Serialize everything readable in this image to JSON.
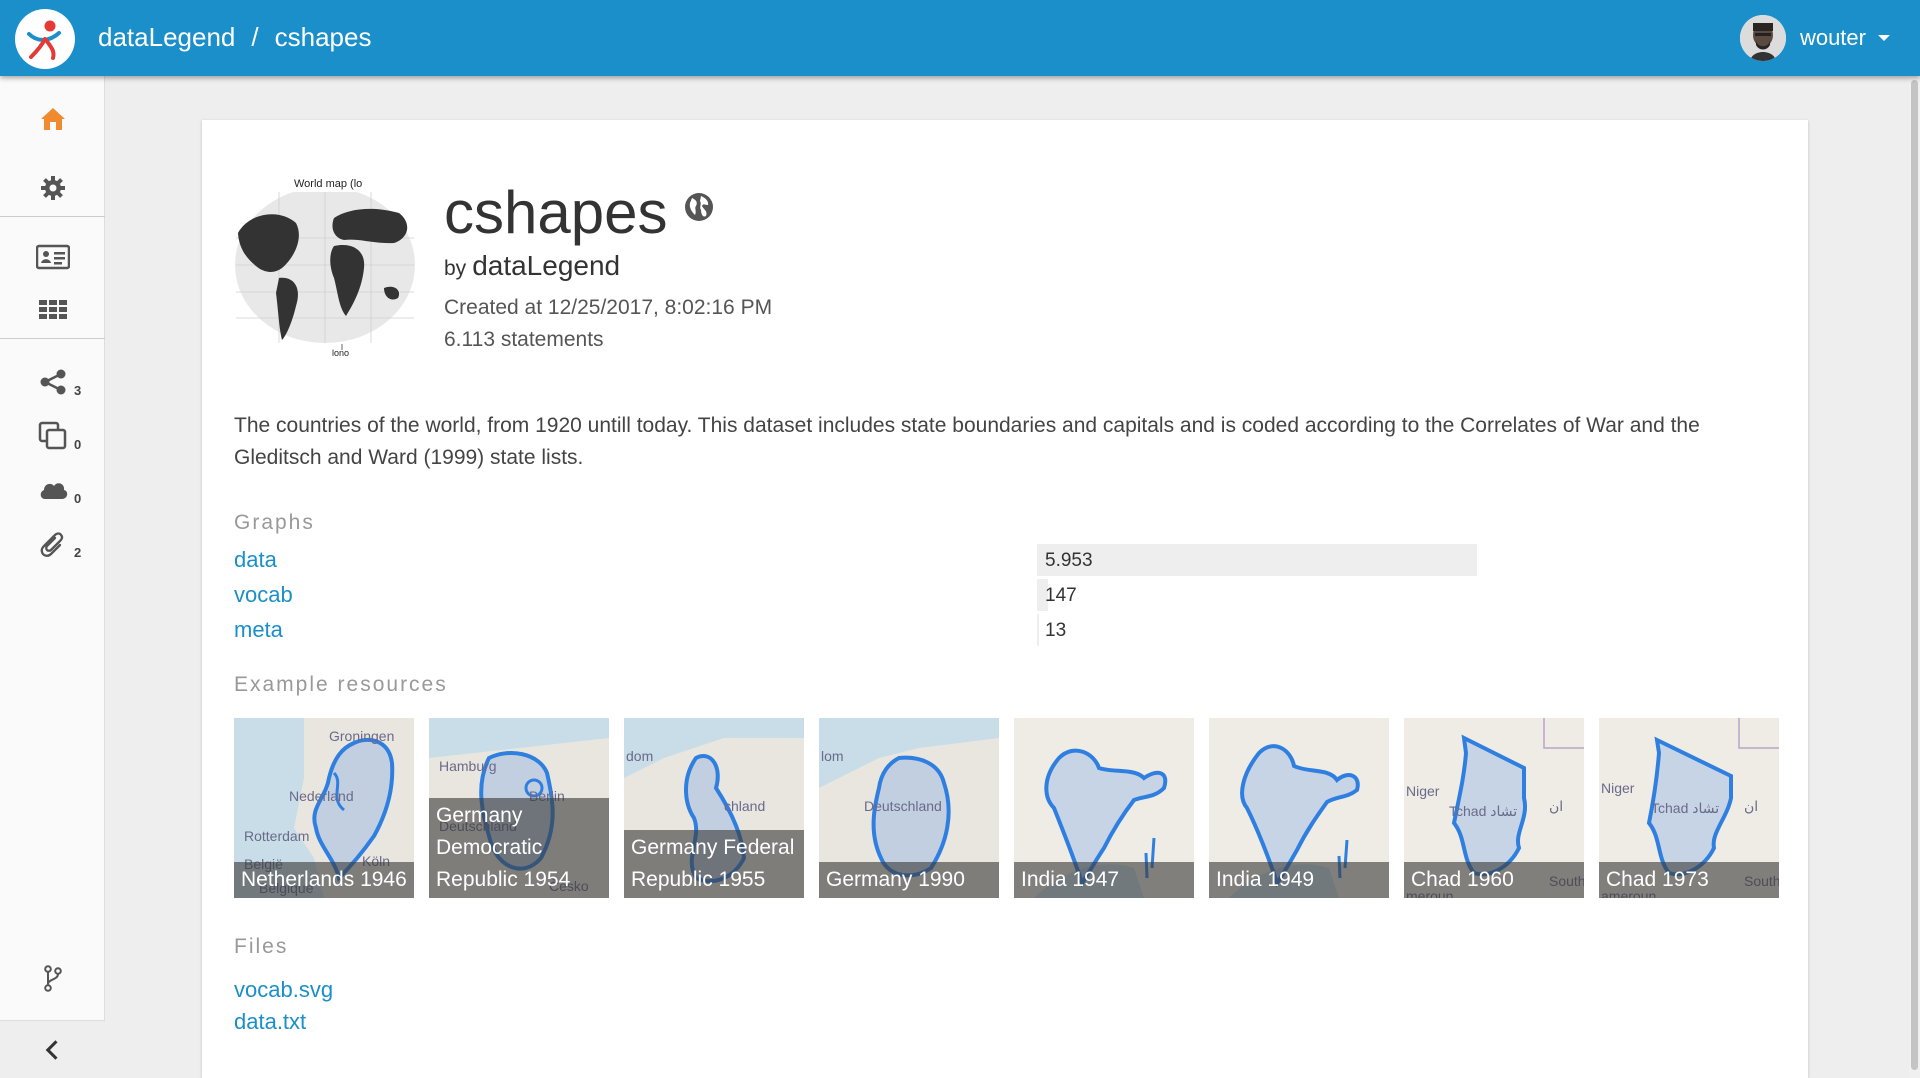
{
  "header": {
    "breadcrumb_org": "dataLegend",
    "breadcrumb_sep": "/",
    "breadcrumb_dataset": "cshapes",
    "user_name": "wouter"
  },
  "sidebar": {
    "counts": {
      "graphs": "3",
      "copies": "0",
      "services": "0",
      "assets": "2"
    }
  },
  "dataset": {
    "title": "cshapes",
    "by_prefix": "by",
    "owner": "dataLegend",
    "created": "Created at 12/25/2017, 8:02:16 PM",
    "statements": "6.113 statements",
    "description": "The countries of the world, from 1920 untill today. This dataset includes state boundaries and capitals and is coded according to the Correlates of War and the Gleditsch and Ward (1999) state lists.",
    "image_caption_top": "World map (lo",
    "image_caption_bottom": "lono"
  },
  "graphs": {
    "heading": "Graphs",
    "items": [
      {
        "name": "data",
        "count": "5.953",
        "fraction": 1.0
      },
      {
        "name": "vocab",
        "count": "147",
        "fraction": 0.025
      },
      {
        "name": "meta",
        "count": "13",
        "fraction": 0.005
      }
    ]
  },
  "examples": {
    "heading": "Example resources",
    "items": [
      {
        "label": "Netherlands 1946",
        "map_labels": [
          "Groningen",
          "Nederland",
          "Rotterdam",
          "België",
          "Belgique",
          "Köln"
        ]
      },
      {
        "label": "Germany Democratic Republic 1954",
        "map_labels": [
          "Hamburg",
          "Berlin",
          "Deutschland",
          "Česko"
        ]
      },
      {
        "label": "Germany Federal Republic 1955",
        "map_labels": [
          "dom",
          "chland"
        ]
      },
      {
        "label": "Germany 1990",
        "map_labels": [
          "lom",
          "Deutschland"
        ]
      },
      {
        "label": "India 1947",
        "map_labels": []
      },
      {
        "label": "India 1949",
        "map_labels": []
      },
      {
        "label": "Chad 1960",
        "map_labels": [
          "Niger",
          "Tchad تشاد",
          "ان",
          "South",
          "meroun"
        ]
      },
      {
        "label": "Chad 1973",
        "map_labels": [
          "Niger",
          "Tchad تشاد",
          "ان",
          "South",
          "ameroun"
        ]
      }
    ]
  },
  "files": {
    "heading": "Files",
    "items": [
      "vocab.svg",
      "data.txt"
    ]
  },
  "colors": {
    "brand": "#1a8fc9",
    "home_active": "#f08a30",
    "outline": "#2f7fe0"
  }
}
